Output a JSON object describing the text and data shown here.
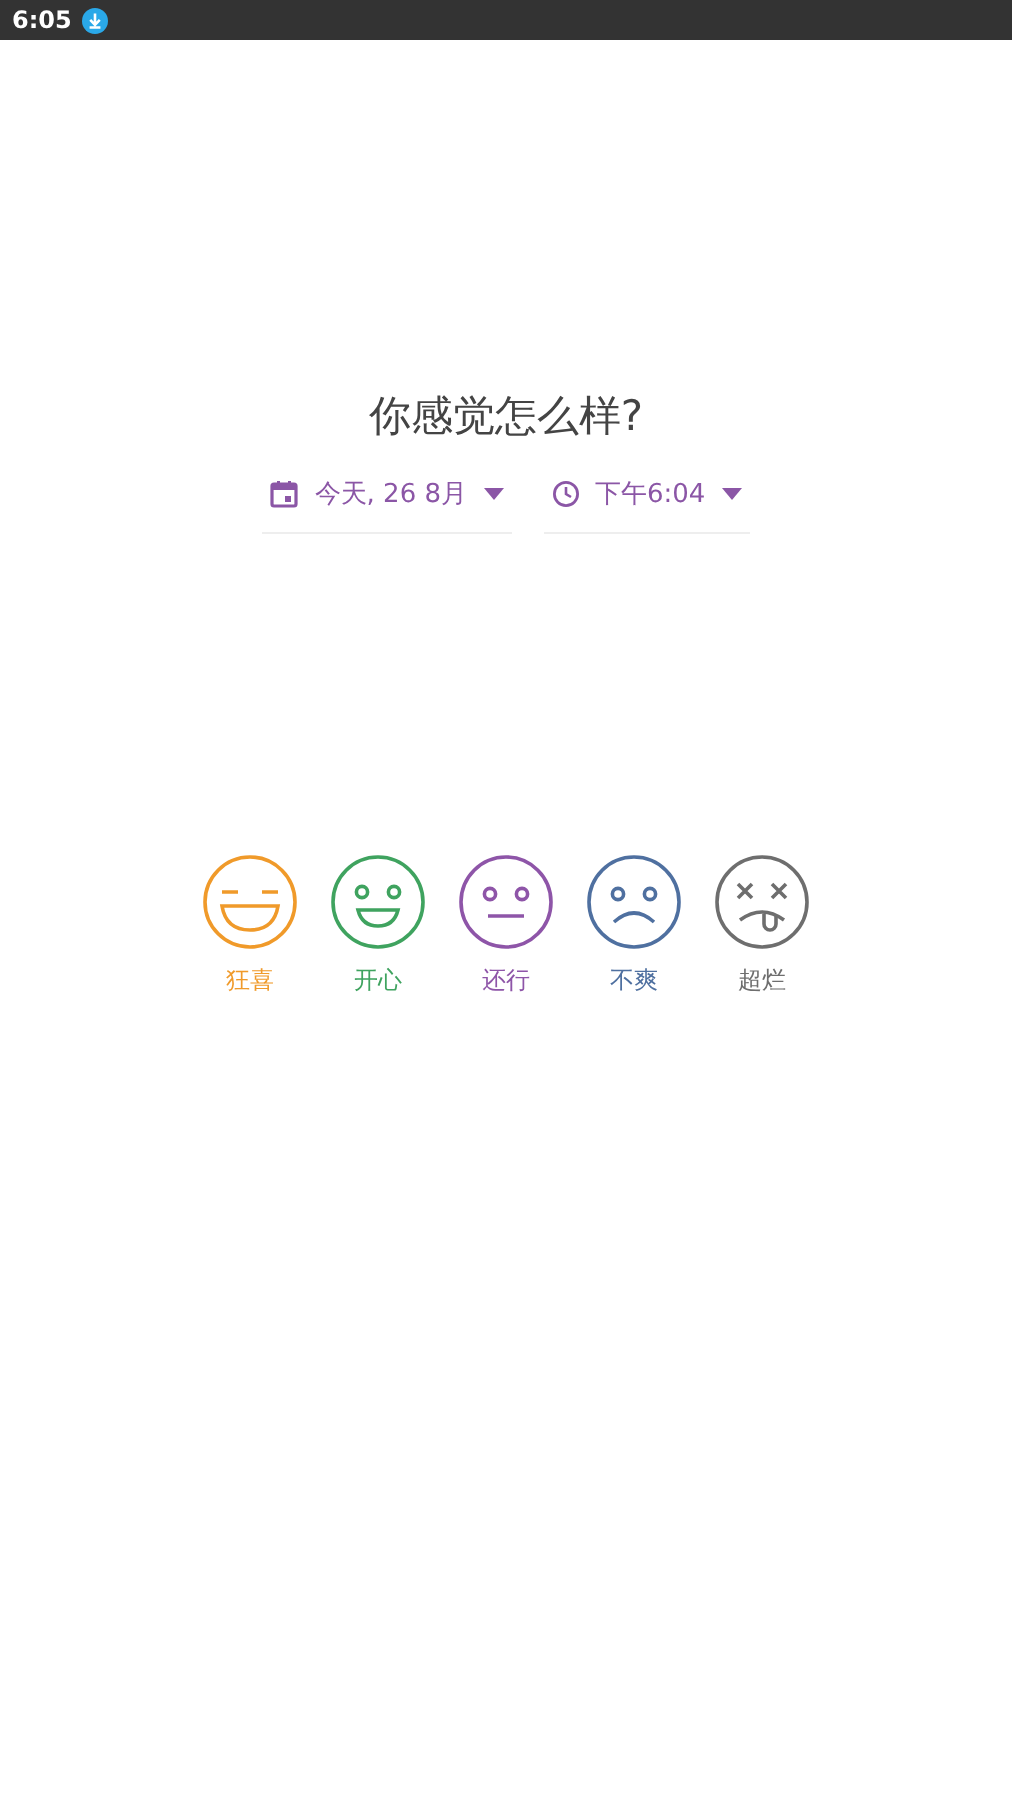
{
  "status_bar": {
    "time": "6:05"
  },
  "title": "你感觉怎么样?",
  "date_picker": {
    "value": "今天, 26 8月"
  },
  "time_picker": {
    "value": "下午6:04"
  },
  "moods": [
    {
      "kind": "rad",
      "label": "狂喜",
      "color": "#f09a2a"
    },
    {
      "kind": "good",
      "label": "开心",
      "color": "#3fa35f"
    },
    {
      "kind": "meh",
      "label": "还行",
      "color": "#8e55a8"
    },
    {
      "kind": "bad",
      "label": "不爽",
      "color": "#4f70a0"
    },
    {
      "kind": "awful",
      "label": "超烂",
      "color": "#6e6e6e"
    }
  ]
}
